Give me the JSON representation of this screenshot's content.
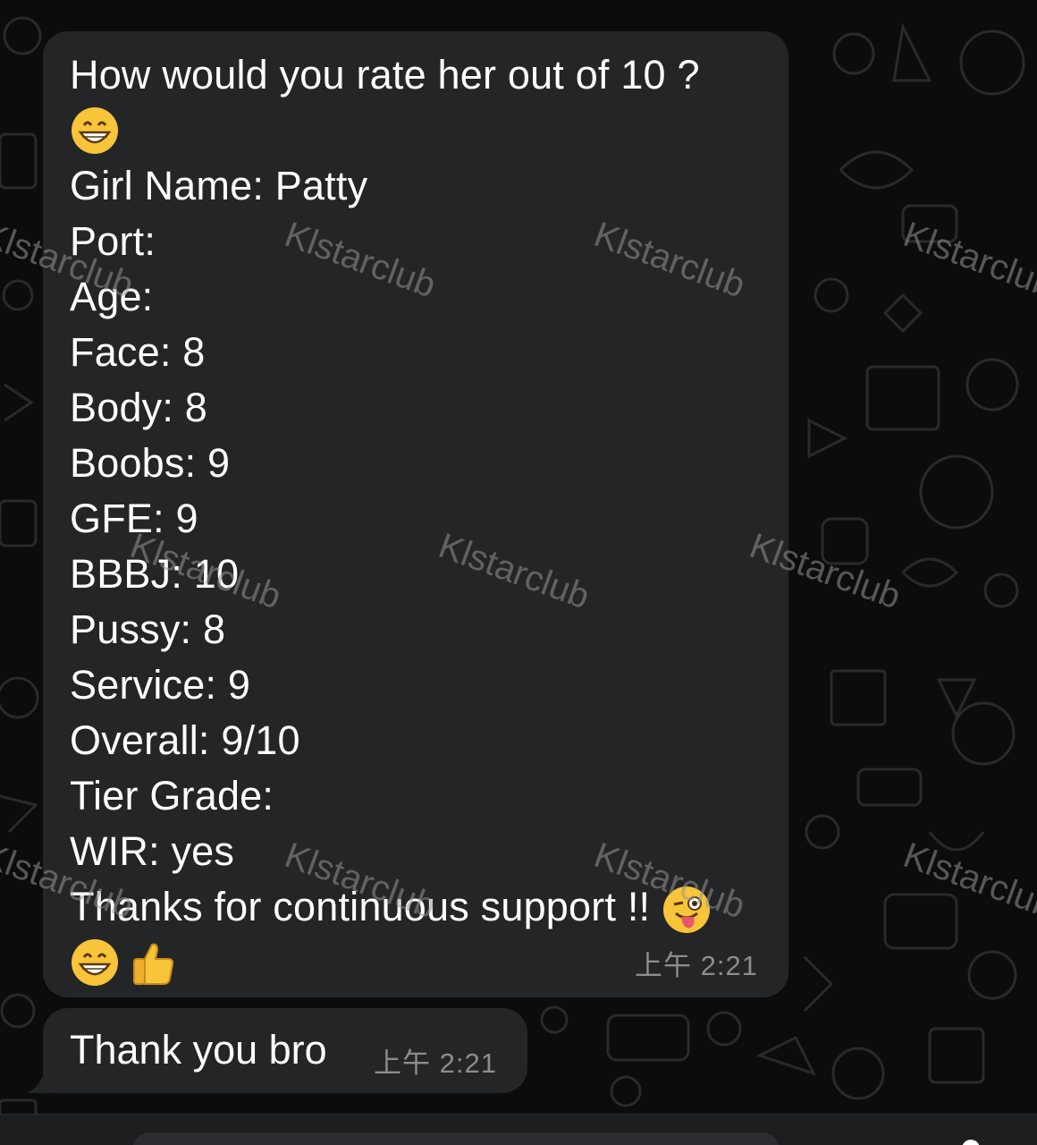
{
  "watermark_text": "Klstarclub",
  "messages": [
    {
      "direction": "incoming",
      "lines": [
        "How would you rate her out of 10 ?",
        "Girl Name: Patty",
        "Port:",
        "Age:",
        "Face: 8",
        "Body: 8",
        "Boobs: 9",
        "GFE: 9",
        "BBBJ: 10",
        "Pussy: 8",
        "Service: 9",
        "Overall: 9/10",
        "Tier Grade:",
        "WIR: yes",
        "Thanks for continuous support !!"
      ],
      "emojis": [
        "grinning-face-with-smiling-eyes",
        "winking-face-with-tongue",
        "grinning-face-with-smiling-eyes",
        "thumbs-up"
      ],
      "time": "上午 2:21"
    },
    {
      "direction": "incoming",
      "text": "Thank you bro",
      "time": "上午 2:21"
    }
  ],
  "colors": {
    "background": "#0c0c0c",
    "bubble": "#242527",
    "text": "#ffffff",
    "timestamp": "#8b8c90"
  }
}
